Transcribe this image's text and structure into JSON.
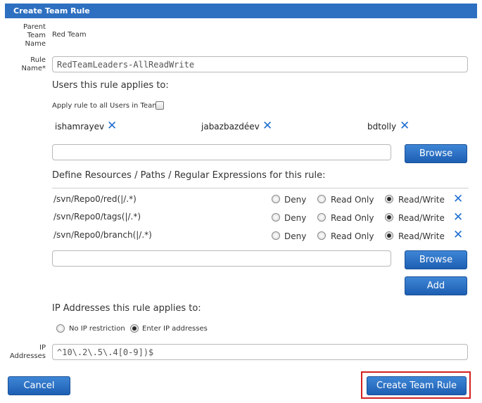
{
  "dialog": {
    "title": "Create Team Rule"
  },
  "parent_team": {
    "label_line1": "Parent",
    "label_line2": "Team",
    "label_line3": "Name",
    "value": "Red Team"
  },
  "rule_name": {
    "label_line1": "Rule",
    "label_line2": "Name*",
    "value": "RedTeamLeaders-AllReadWrite"
  },
  "users": {
    "heading": "Users this rule applies to:",
    "apply_all_label": "Apply rule to all Users in Team",
    "apply_all_checked": false,
    "list": [
      {
        "name": "ishamrayev"
      },
      {
        "name": "jabazbazdéev"
      },
      {
        "name": "bdtolly"
      }
    ],
    "remove_glyph": "✕",
    "input_value": "",
    "browse_label": "Browse"
  },
  "resources": {
    "heading": "Define Resources / Paths / Regular Expressions for this rule:",
    "options": {
      "deny": "Deny",
      "read_only": "Read Only",
      "read_write": "Read/Write"
    },
    "rows": [
      {
        "path": "/svn/Repo0/red(|/.*)",
        "selected": "read_write"
      },
      {
        "path": "/svn/Repo0/tags(|/.*)",
        "selected": "read_write"
      },
      {
        "path": "/svn/Repo0/branch(|/.*)",
        "selected": "read_write"
      }
    ],
    "input_value": "",
    "browse_label": "Browse",
    "add_label": "Add"
  },
  "ip": {
    "heading": "IP Addresses this rule applies to:",
    "no_restriction_label": "No IP restriction",
    "enter_label": "Enter IP addresses",
    "selected": "enter",
    "field_label_line1": "IP",
    "field_label_line2": "Addresses",
    "value": "^10\\.2\\.5\\.4[0-9])$"
  },
  "footer": {
    "cancel_label": "Cancel",
    "create_label": "Create Team Rule"
  },
  "colors": {
    "accent": "#2d6fc0",
    "highlight": "#d42020",
    "remove_icon": "#1e6fd2"
  }
}
